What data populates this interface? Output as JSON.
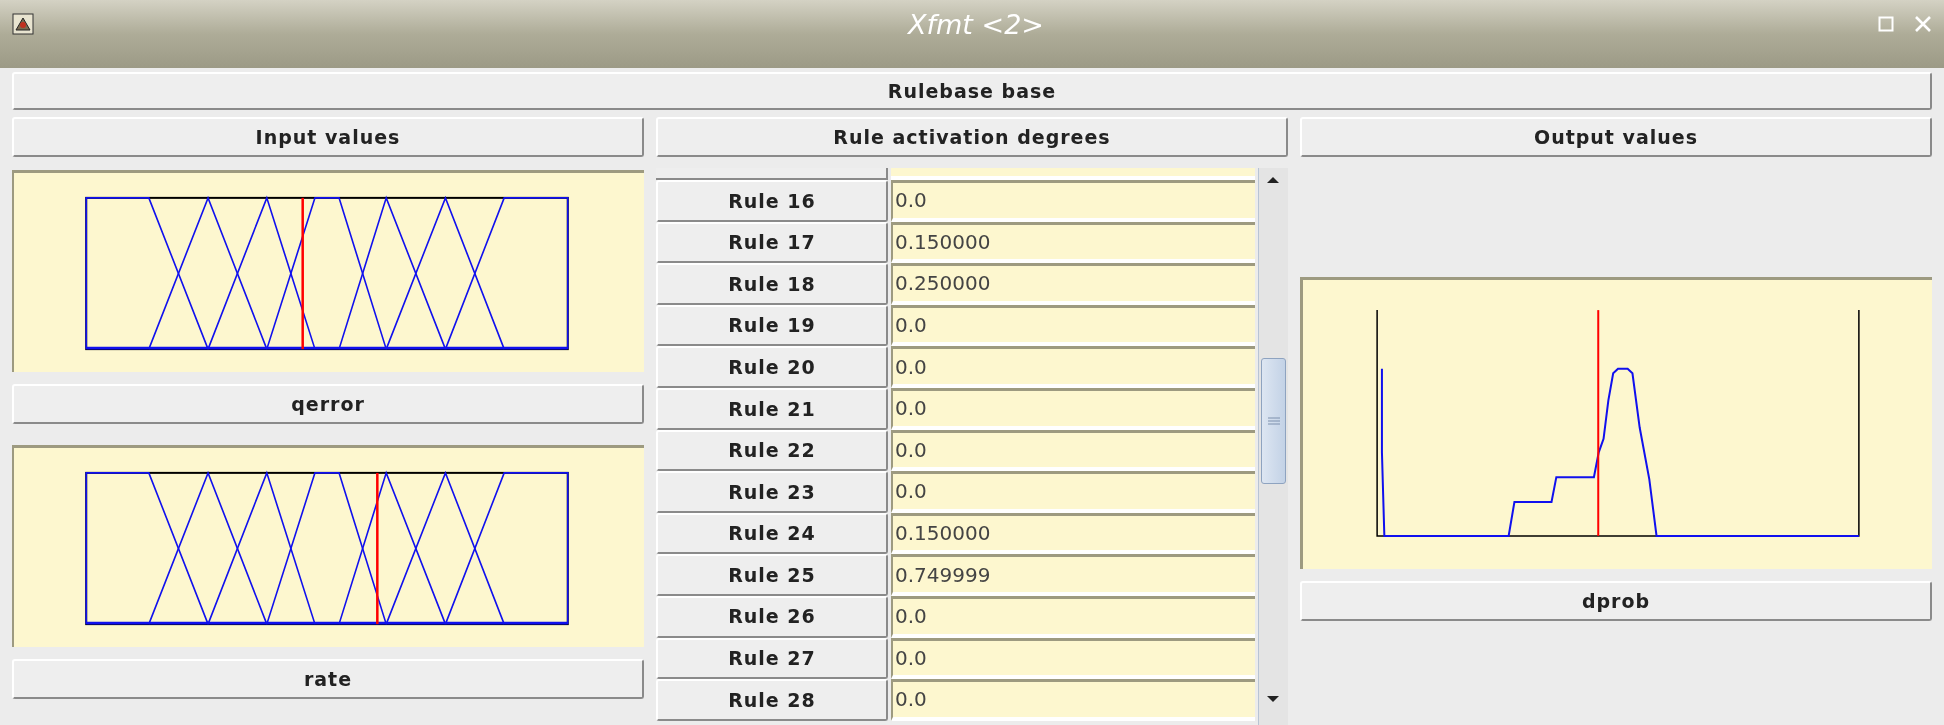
{
  "window": {
    "title": "Xfmt <2>"
  },
  "rulebase": {
    "label": "Rulebase base"
  },
  "columns": [
    {
      "label": "Input values"
    },
    {
      "label": "Rule activation degrees"
    },
    {
      "label": "Output values"
    }
  ],
  "inputs": [
    {
      "name": "qerror",
      "level": 0.449
    },
    {
      "name": "rate",
      "level": 0.604
    }
  ],
  "rules": [
    {
      "label": "Rule 16",
      "value": "0.0"
    },
    {
      "label": "Rule 17",
      "value": "0.150000"
    },
    {
      "label": "Rule 18",
      "value": "0.250000"
    },
    {
      "label": "Rule 19",
      "value": "0.0"
    },
    {
      "label": "Rule 20",
      "value": "0.0"
    },
    {
      "label": "Rule 21",
      "value": "0.0"
    },
    {
      "label": "Rule 22",
      "value": "0.0"
    },
    {
      "label": "Rule 23",
      "value": "0.0"
    },
    {
      "label": "Rule 24",
      "value": "0.150000"
    },
    {
      "label": "Rule 25",
      "value": "0.749999"
    },
    {
      "label": "Rule 26",
      "value": "0.0"
    },
    {
      "label": "Rule 27",
      "value": "0.0"
    },
    {
      "label": "Rule 28",
      "value": "0.0"
    }
  ],
  "outputs": [
    {
      "name": "dprob",
      "level": 0.459
    }
  ]
}
